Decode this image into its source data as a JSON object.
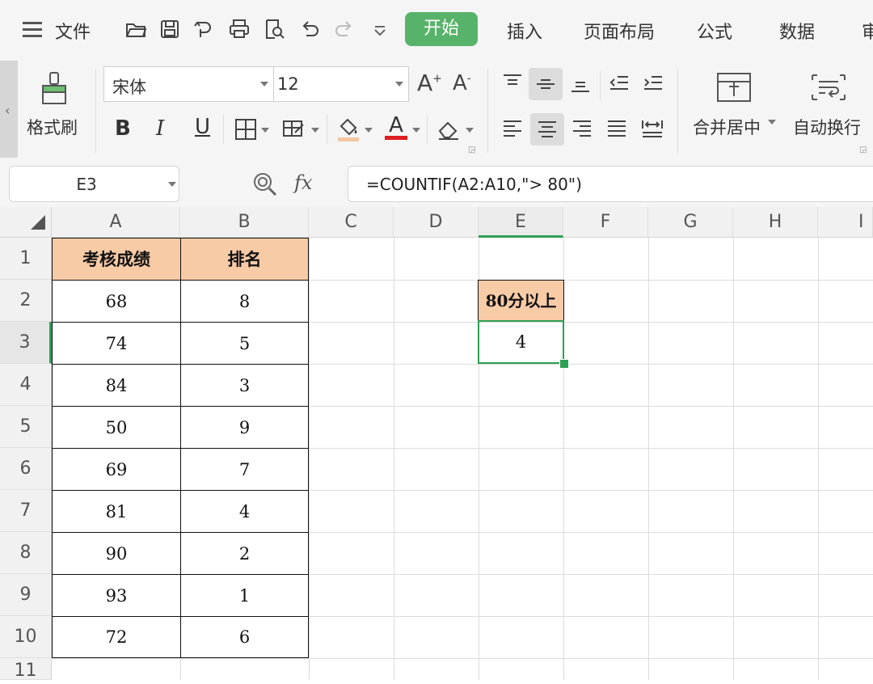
{
  "menu": {
    "hamburger_label": "文件",
    "tabs": [
      "开始",
      "插入",
      "页面布局",
      "公式",
      "数据",
      "审"
    ],
    "active_tab": "开始"
  },
  "ribbon": {
    "format_painter_label": "格式刷",
    "font_name": "宋体",
    "font_size": "12",
    "merge_center_label": "合并居中",
    "wrap_text_label": "自动换行",
    "bold_label": "B",
    "italic_label": "I",
    "underline_label": "U",
    "grow_font": "A",
    "shrink_font": "A",
    "font_color_label": "A"
  },
  "formula_bar": {
    "name_box": "E3",
    "fx_label": "fx",
    "formula": "=COUNTIF(A2:A10,\"> 80\")"
  },
  "sheet": {
    "columns": [
      "A",
      "B",
      "C",
      "D",
      "E",
      "F",
      "G",
      "H",
      "I"
    ],
    "rows": [
      "1",
      "2",
      "3",
      "4",
      "5",
      "6",
      "7",
      "8",
      "9",
      "10",
      "11"
    ],
    "active_column": "E",
    "active_row": "3",
    "table_headers": [
      "考核成绩",
      "排名"
    ],
    "table_rows": [
      [
        "68",
        "8"
      ],
      [
        "74",
        "5"
      ],
      [
        "84",
        "3"
      ],
      [
        "50",
        "9"
      ],
      [
        "69",
        "7"
      ],
      [
        "81",
        "4"
      ],
      [
        "90",
        "2"
      ],
      [
        "93",
        "1"
      ],
      [
        "72",
        "6"
      ]
    ],
    "e2_label": "80分以上",
    "e3_value": "4"
  },
  "colors": {
    "accent_green": "#58b36a",
    "selection_green": "#2e9f55",
    "header_fill": "#f8cba7"
  }
}
